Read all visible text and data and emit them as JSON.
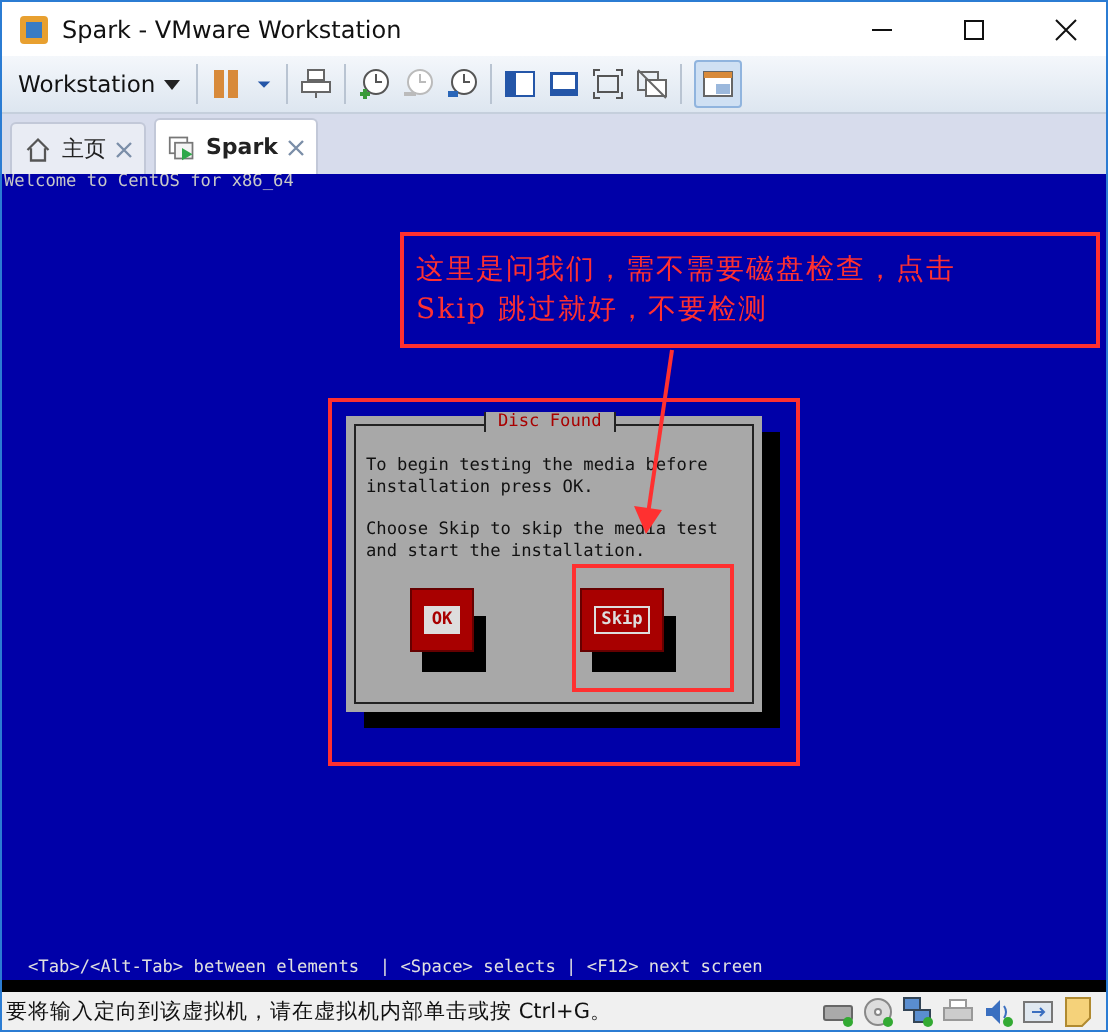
{
  "window": {
    "title": "Spark - VMware Workstation"
  },
  "toolbar": {
    "menu": "Workstation"
  },
  "tabs": [
    {
      "label": "主页",
      "selected": false,
      "kind": "home"
    },
    {
      "label": "Spark",
      "selected": true,
      "kind": "vm"
    }
  ],
  "console": {
    "header": "Welcome to CentOS for x86_64",
    "hint": "<Tab>/<Alt-Tab> between elements  | <Space> selects | <F12> next screen"
  },
  "dialog": {
    "title": "Disc Found",
    "paragraphs": [
      "To begin testing the media before installation press OK.",
      "Choose Skip to skip the media test and start the installation."
    ],
    "buttons": [
      {
        "label": "OK",
        "focused": true
      },
      {
        "label": "Skip",
        "focused": false
      }
    ]
  },
  "annotation": {
    "text": "这里是问我们，需不需要磁盘检查，点击 Skip 跳过就好，不要检测"
  },
  "status_bar": {
    "text": "要将输入定向到该虚拟机，请在虚拟机内部单击或按 Ctrl+G。"
  }
}
